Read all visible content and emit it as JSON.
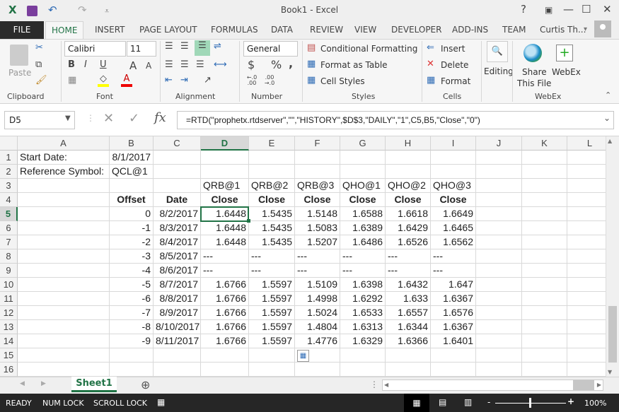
{
  "window": {
    "title": "Book1 - Excel",
    "help": "?",
    "minimize": "—",
    "maximize": "☐",
    "close": "✕"
  },
  "qat": {
    "excel_icon": "X",
    "save_icon": "💾",
    "undo_icon": "↶",
    "redo_icon": "↷",
    "customize_icon": "⩡"
  },
  "tabs": [
    {
      "label": "FILE"
    },
    {
      "label": "HOME"
    },
    {
      "label": "INSERT"
    },
    {
      "label": "PAGE LAYOUT"
    },
    {
      "label": "FORMULAS"
    },
    {
      "label": "DATA"
    },
    {
      "label": "REVIEW"
    },
    {
      "label": "VIEW"
    },
    {
      "label": "DEVELOPER"
    },
    {
      "label": "ADD-INS"
    },
    {
      "label": "TEAM"
    }
  ],
  "user": {
    "name": "Curtis Th...",
    "chevron": "▾"
  },
  "ribbon": {
    "clipboard": {
      "label": "Clipboard",
      "paste": "Paste"
    },
    "font": {
      "label": "Font",
      "name": "Calibri",
      "size": "11",
      "bold": "B",
      "italic": "I",
      "underline": "U",
      "grow": "A",
      "shrink": "A",
      "font_color": "A"
    },
    "alignment": {
      "label": "Alignment"
    },
    "number": {
      "label": "Number",
      "format": "General",
      "currency": "$",
      "percent": "%",
      "comma": ",",
      "inc_dec": "←.0 .00",
      "dec_dec": ".00 →.0"
    },
    "styles": {
      "label": "Styles",
      "conditional": "Conditional Formatting",
      "format_table": "Format as Table",
      "cell_styles": "Cell Styles"
    },
    "cells": {
      "label": "Cells",
      "insert": "Insert",
      "delete": "Delete",
      "format": "Format"
    },
    "editing": {
      "label": "Editing"
    },
    "webex": {
      "label": "WebEx",
      "share": "Share",
      "share2": "This File",
      "webex": "WebEx"
    }
  },
  "formula_bar": {
    "name_box": "D5",
    "cancel": "✕",
    "enter": "✓",
    "fx": "fx",
    "formula": "=RTD(\"prophetx.rtdserver\",\"\",\"HISTORY\",$D$3,\"DAILY\",\"1\",C5,B5,\"Close\",\"0\")"
  },
  "sheet": {
    "columns": [
      "A",
      "B",
      "C",
      "D",
      "E",
      "F",
      "G",
      "H",
      "I",
      "J",
      "K",
      "L"
    ],
    "selected_cell": "D5",
    "rows": [
      [
        "Start Date:",
        "8/1/2017",
        "",
        "",
        "",
        "",
        "",
        "",
        "",
        "",
        "",
        ""
      ],
      [
        "Reference Symbol:",
        "QCL@1",
        "",
        "",
        "",
        "",
        "",
        "",
        "",
        "",
        "",
        ""
      ],
      [
        "",
        "",
        "",
        "QRB@1",
        "QRB@2",
        "QRB@3",
        "QHO@1",
        "QHO@2",
        "QHO@3",
        "",
        "",
        ""
      ],
      [
        "",
        "Offset",
        "Date",
        "Close",
        "Close",
        "Close",
        "Close",
        "Close",
        "Close",
        "",
        "",
        ""
      ],
      [
        "",
        "0",
        "8/2/2017",
        "1.6448",
        "1.5435",
        "1.5148",
        "1.6588",
        "1.6618",
        "1.6649",
        "",
        "",
        ""
      ],
      [
        "",
        "-1",
        "8/3/2017",
        "1.6448",
        "1.5435",
        "1.5083",
        "1.6389",
        "1.6429",
        "1.6465",
        "",
        "",
        ""
      ],
      [
        "",
        "-2",
        "8/4/2017",
        "1.6448",
        "1.5435",
        "1.5207",
        "1.6486",
        "1.6526",
        "1.6562",
        "",
        "",
        ""
      ],
      [
        "",
        "-3",
        "8/5/2017",
        "---",
        "---",
        "---",
        "---",
        "---",
        "---",
        "",
        "",
        ""
      ],
      [
        "",
        "-4",
        "8/6/2017",
        "---",
        "---",
        "---",
        "---",
        "---",
        "---",
        "",
        "",
        ""
      ],
      [
        "",
        "-5",
        "8/7/2017",
        "1.6766",
        "1.5597",
        "1.5109",
        "1.6398",
        "1.6432",
        "1.647",
        "",
        "",
        ""
      ],
      [
        "",
        "-6",
        "8/8/2017",
        "1.6766",
        "1.5597",
        "1.4998",
        "1.6292",
        "1.633",
        "1.6367",
        "",
        "",
        ""
      ],
      [
        "",
        "-7",
        "8/9/2017",
        "1.6766",
        "1.5597",
        "1.5024",
        "1.6533",
        "1.6557",
        "1.6576",
        "",
        "",
        ""
      ],
      [
        "",
        "-8",
        "8/10/2017",
        "1.6766",
        "1.5597",
        "1.4804",
        "1.6313",
        "1.6344",
        "1.6367",
        "",
        "",
        ""
      ],
      [
        "",
        "-9",
        "8/11/2017",
        "1.6766",
        "1.5597",
        "1.4776",
        "1.6329",
        "1.6366",
        "1.6401",
        "",
        "",
        ""
      ],
      [
        "",
        "",
        "",
        "",
        "",
        "",
        "",
        "",
        "",
        "",
        "",
        ""
      ],
      [
        "",
        "",
        "",
        "",
        "",
        "",
        "",
        "",
        "",
        "",
        "",
        ""
      ]
    ]
  },
  "sheet_tabs": [
    {
      "label": "Sheet1"
    }
  ],
  "add_sheet": "⊕",
  "status": {
    "ready": "READY",
    "num_lock": "NUM LOCK",
    "scroll_lock": "SCROLL LOCK",
    "zoom": "100%",
    "zoom_minus": "-",
    "zoom_plus": "+"
  },
  "colors": {
    "accent": "#217346",
    "file_tab": "#2b2b2b",
    "status_bar": "#262626"
  }
}
